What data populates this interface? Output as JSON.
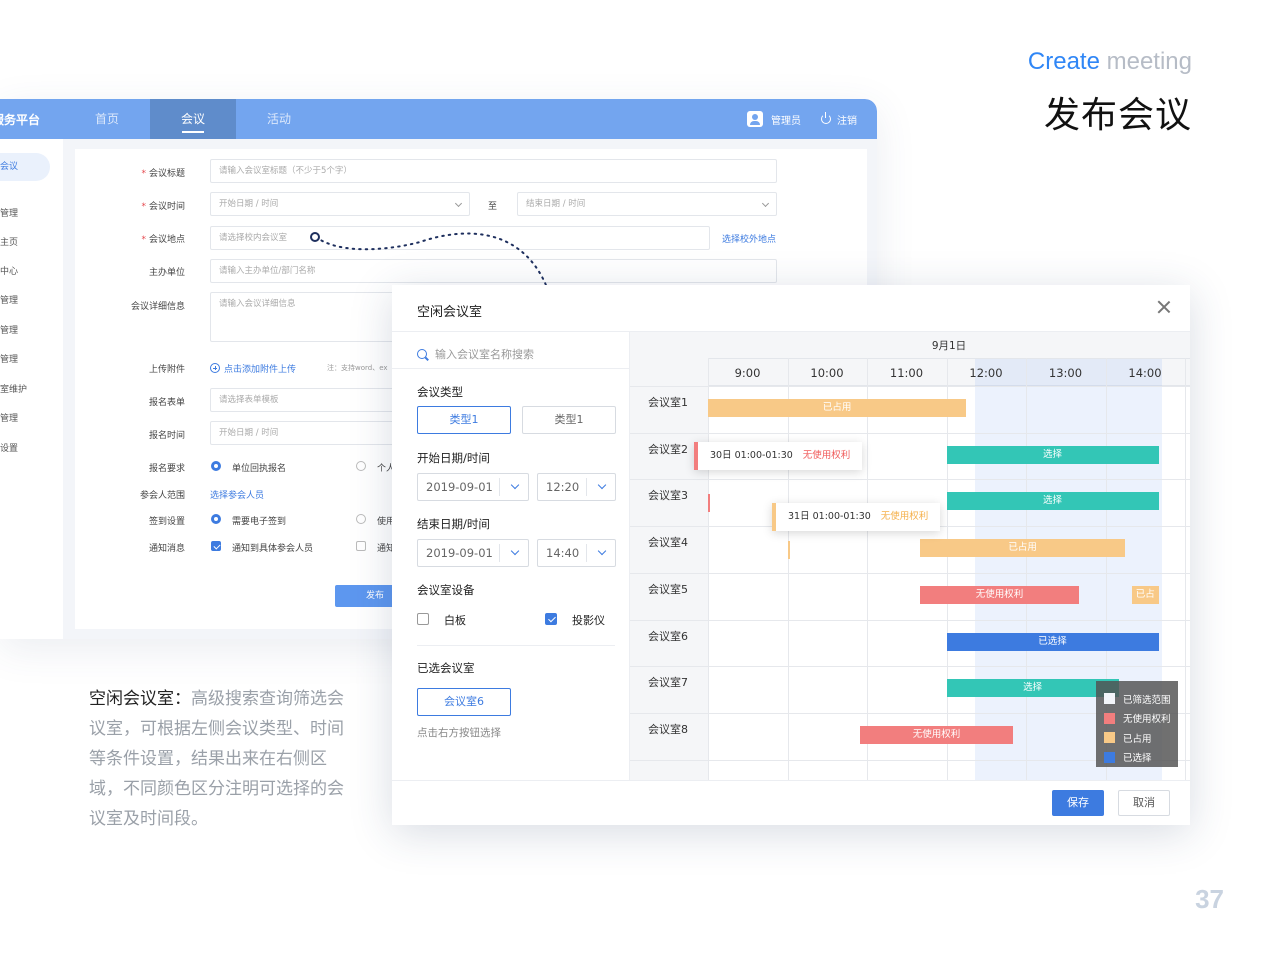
{
  "heading": {
    "en_part1": "Create",
    "en_part2": "meeting",
    "cn": "发布会议"
  },
  "page_number": "37",
  "app": {
    "brand": "服务平台",
    "nav": [
      "首页",
      "会议",
      "活动"
    ],
    "user_label": "管理员",
    "logout_label": "注销",
    "sidebar": [
      "会议",
      "管理",
      "主页",
      "中心",
      "管理",
      "管理",
      "管理",
      "室维护",
      "管理",
      "设置"
    ]
  },
  "form": {
    "title_label": "会议标题",
    "title_placeholder": "请输入会议室标题（不少于5个字）",
    "time_label": "会议时间",
    "start_placeholder": "开始日期 / 时间",
    "to_label": "至",
    "end_placeholder": "结束日期 / 时间",
    "location_label": "会议地点",
    "location_placeholder": "请选择校内会议室",
    "location_link": "选择校外地点",
    "host_label": "主办单位",
    "host_placeholder": "请输入主办单位/部门名称",
    "detail_label": "会议详细信息",
    "detail_placeholder": "请输入会议详细信息",
    "attach_label": "上传附件",
    "attach_link": "点击添加附件上传",
    "attach_hint": "注：支持word、ex",
    "signup_form_label": "报名表单",
    "signup_form_placeholder": "请选择表单模板",
    "signup_time_label": "报名时间",
    "signup_time_placeholder": "开始日期 / 时间",
    "signup_req_label": "报名要求",
    "signup_req_opt1": "单位回执报名",
    "signup_req_opt2": "个人",
    "scope_label": "参会人范围",
    "scope_link": "选择参会人员",
    "checkin_label": "签到设置",
    "checkin_opt1": "需要电子签到",
    "checkin_opt2": "使用",
    "notify_label": "通知消息",
    "notify_opt1": "通知到具体参会人员",
    "notify_opt2": "通知",
    "publish": "发布"
  },
  "description": {
    "title": "空闲会议室：",
    "body": "高级搜索查询筛选会议室，可根据左侧会议类型、时间等条件设置，结果出来在右侧区域，不同颜色区分注明可选择的会议室及时间段。"
  },
  "modal": {
    "title": "空闲会议室",
    "search_placeholder": "输入会议室名称搜索",
    "type_label": "会议类型",
    "type_options": [
      "类型1",
      "类型1"
    ],
    "start_label": "开始日期/时间",
    "start_date": "2019-09-01",
    "start_time": "12:20",
    "end_label": "结束日期/时间",
    "end_date": "2019-09-01",
    "end_time": "14:40",
    "equipment_label": "会议室设备",
    "equipment": [
      {
        "label": "白板",
        "checked": false
      },
      {
        "label": "投影仪",
        "checked": true
      }
    ],
    "selected_label": "已选会议室",
    "selected_room": "会议室6",
    "selected_note": "点击右方按钮选择",
    "save": "保存",
    "cancel": "取消"
  },
  "schedule": {
    "date": "9月1日",
    "hours": [
      "9:00",
      "10:00",
      "11:00",
      "12:00",
      "13:00",
      "14:00"
    ],
    "rooms": [
      "会议室1",
      "会议室2",
      "会议室3",
      "会议室4",
      "会议室5",
      "会议室6",
      "会议室7",
      "会议室8"
    ],
    "bars": [
      {
        "room": 0,
        "start": "9:00",
        "end": "12:15",
        "type": "booked",
        "label": "已占用"
      },
      {
        "room": 1,
        "start": "12:00",
        "end": "14:40",
        "type": "choose",
        "label": "选择"
      },
      {
        "room": 2,
        "start": "12:00",
        "end": "14:40",
        "type": "choose",
        "label": "选择"
      },
      {
        "room": 3,
        "start": "11:40",
        "end": "14:15",
        "type": "booked",
        "label": "已占用"
      },
      {
        "room": 4,
        "start": "11:40",
        "end": "13:40",
        "type": "norights",
        "label": "无使用权利"
      },
      {
        "room": 4,
        "start": "14:20",
        "end": "14:40",
        "type": "booked",
        "label": "已占"
      },
      {
        "room": 5,
        "start": "12:00",
        "end": "14:40",
        "type": "chosen",
        "label": "已选择"
      },
      {
        "room": 6,
        "start": "12:00",
        "end": "14:10",
        "type": "choose",
        "label": "选择"
      },
      {
        "room": 7,
        "start": "10:55",
        "end": "12:50",
        "type": "norights",
        "label": "无使用权利"
      }
    ],
    "tooltips": [
      {
        "text": "30日 01:00-01:30",
        "status": "无使用权利"
      },
      {
        "text": "31日 01:00-01:30",
        "status": "无使用权利"
      }
    ],
    "legend": [
      {
        "label": "已筛选范围",
        "color": "#f2f5fa"
      },
      {
        "label": "无使用权利",
        "color": "#f27e7e"
      },
      {
        "label": "已占用",
        "color": "#f8c987"
      },
      {
        "label": "已选择",
        "color": "#3d7be0"
      }
    ]
  }
}
